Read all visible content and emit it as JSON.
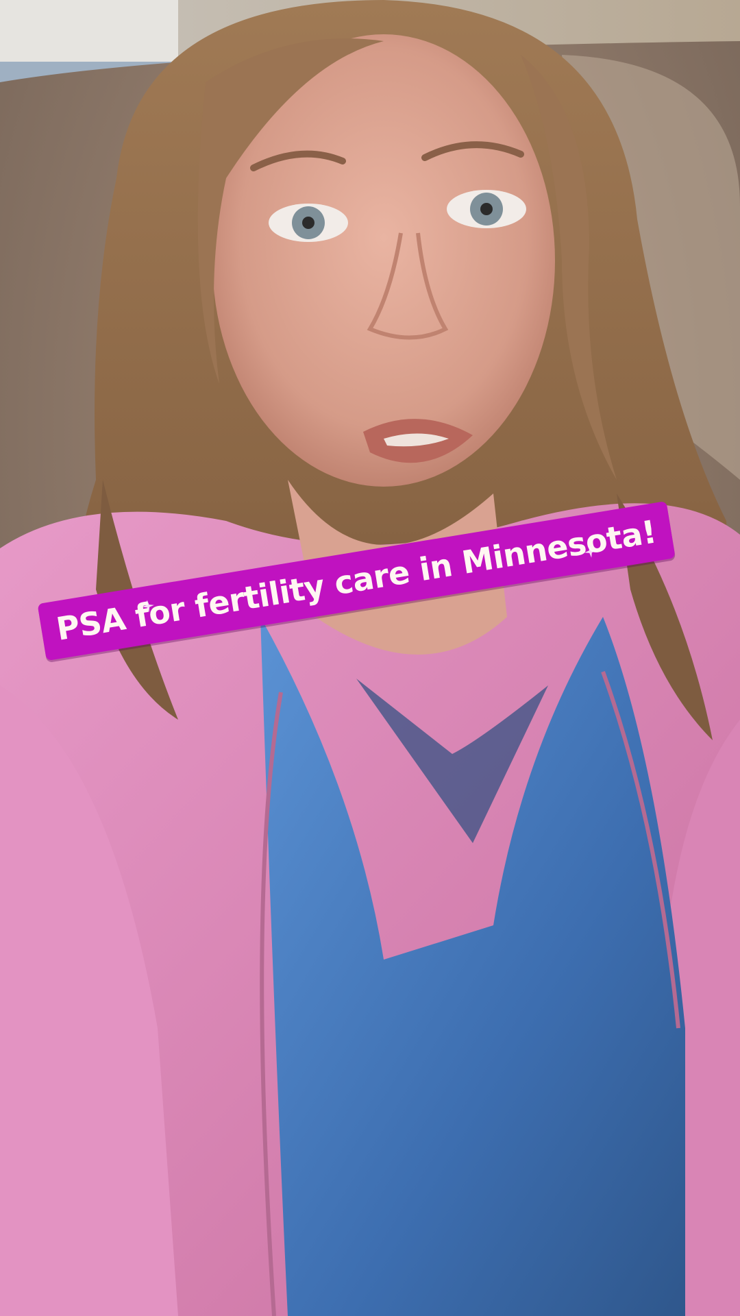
{
  "caption": {
    "text": "PSA for fertility care in Minnesota!",
    "background_color": "#c012c0",
    "text_color": "#fff7f2"
  },
  "scene": {
    "description_icon": "selfie-video-frame"
  }
}
